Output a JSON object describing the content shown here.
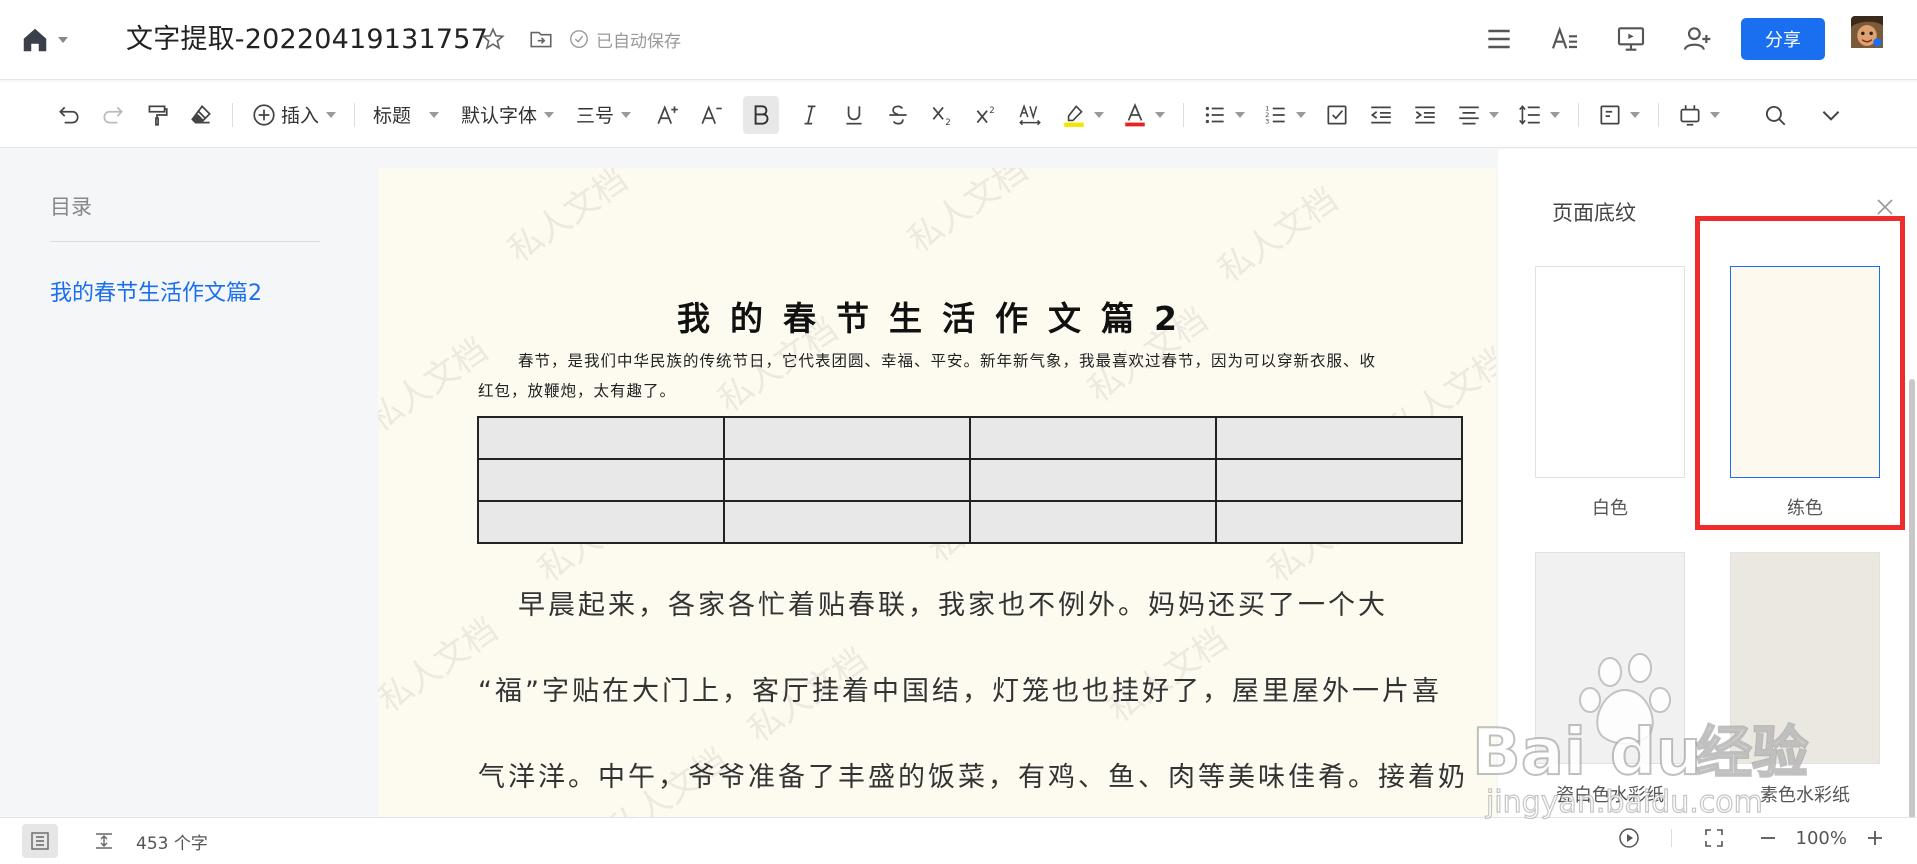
{
  "header": {
    "title": "文字提取-20220419131757",
    "autosave": "已自动保存",
    "share_label": "分享"
  },
  "toolbar": {
    "insert_label": "插入",
    "heading_label": "标题",
    "font_label": "默认字体",
    "size_label": "三号"
  },
  "outline": {
    "heading": "目录",
    "items": [
      "我的春节生活作文篇2"
    ]
  },
  "document": {
    "watermark": "私人文档",
    "heading": "我的春节生活作文篇2",
    "intro": "春节，是我们中华民族的传统节日，它代表团圆、幸福、平安。新年新气象，我最喜欢过春节，因为可以穿新衣服、收红包，放鞭炮，太有趣了。",
    "paragraphs": [
      "早晨起来，各家各忙着贴春联，我家也不例外。妈妈还买了一个大",
      "“福”字贴在大门上，客厅挂着中国结，灯笼也也挂好了，屋里屋外一片喜",
      "气洋洋。中午，爷爷准备了丰盛的饭菜，有鸡、鱼、肉等美味佳肴。接着奶"
    ]
  },
  "panel": {
    "title": "页面底纹",
    "swatches": [
      {
        "label": "白色",
        "color": "#ffffff"
      },
      {
        "label": "练色",
        "color": "#fdf9ee"
      },
      {
        "label": "瓷白色水彩纸",
        "color": "#f1f1f1"
      },
      {
        "label": "素色水彩纸",
        "color": "#ebe7e1"
      }
    ]
  },
  "status": {
    "word_count": "453 个字",
    "zoom": "100%"
  },
  "watermark": {
    "brand": "Bai",
    "brand2": "du",
    "brand_cn": "经验",
    "url": "jingyan.baidu.com"
  },
  "colors": {
    "accent": "#1a6ff0",
    "highlight": "#ee2c2c",
    "page_bg": "#fdfaf0"
  }
}
